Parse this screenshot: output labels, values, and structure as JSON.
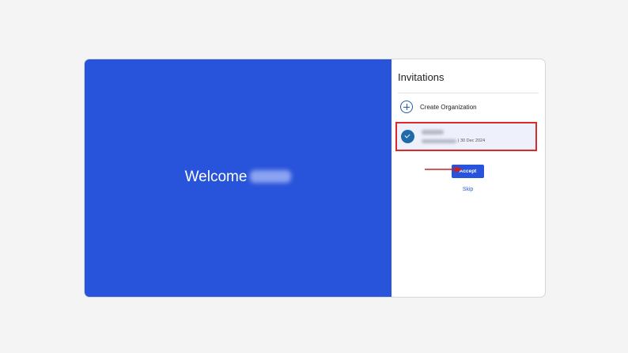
{
  "hero": {
    "welcome_text": "Welcome"
  },
  "panel": {
    "title": "Invitations",
    "create_org_label": "Create Organization",
    "invitation": {
      "date": "30 Dec 2024"
    },
    "accept_label": "Accept",
    "skip_label": "Skip"
  },
  "colors": {
    "hero_bg": "#2853db",
    "accent": "#1f6aa8",
    "highlight": "#d92b2b",
    "annotation_arrow": "#c92020"
  },
  "icons": {
    "create": "plus-circle-icon",
    "selected": "check-circle-icon",
    "annotation": "arrow-right-icon"
  }
}
